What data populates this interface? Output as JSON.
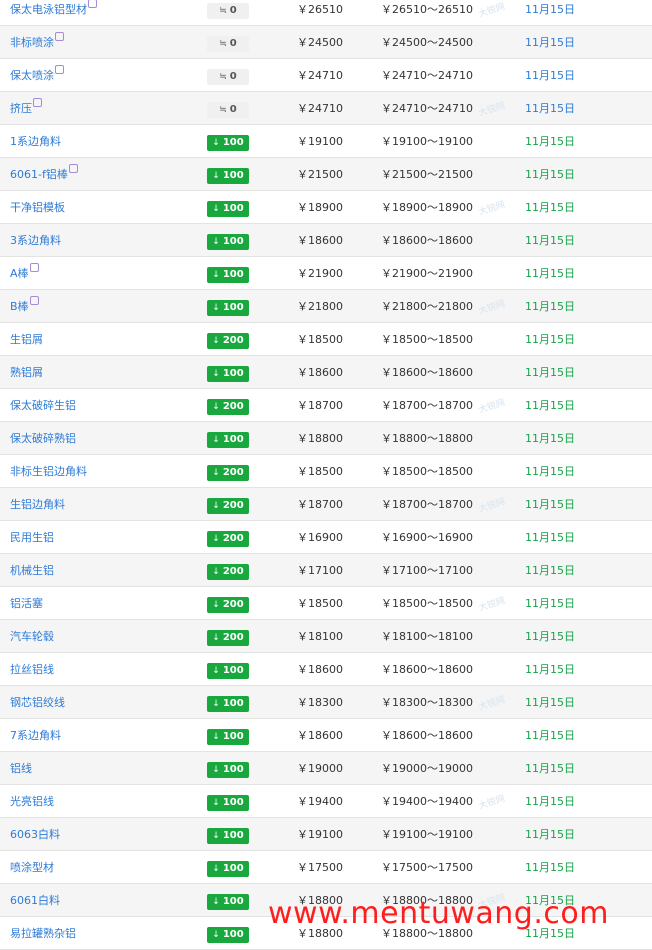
{
  "colors": {
    "link": "#2e7bd6",
    "down_badge": "#19a83e",
    "flat_badge": "#f0f0f0",
    "date_green": "#16a34a",
    "date_blue": "#2e7bd6",
    "watermark": "#ff1e1e"
  },
  "flat_icon": "≒",
  "down_icon": "↓",
  "watermark_text": "www.mentuwang.com",
  "row_watermark": "大锐网",
  "rows": [
    {
      "name": "保太电泳铝型材",
      "sup": true,
      "change": "0",
      "dir": "flat",
      "price": "￥26510",
      "range": "￥26510～26510",
      "date": "11月15日",
      "date_color": "blue"
    },
    {
      "name": "非标喷涂",
      "sup": true,
      "change": "0",
      "dir": "flat",
      "price": "￥24500",
      "range": "￥24500～24500",
      "date": "11月15日",
      "date_color": "blue"
    },
    {
      "name": "保太喷涂",
      "sup": true,
      "change": "0",
      "dir": "flat",
      "price": "￥24710",
      "range": "￥24710～24710",
      "date": "11月15日",
      "date_color": "blue"
    },
    {
      "name": "挤压",
      "sup": true,
      "change": "0",
      "dir": "flat",
      "price": "￥24710",
      "range": "￥24710～24710",
      "date": "11月15日",
      "date_color": "blue"
    },
    {
      "name": "1系边角料",
      "sup": false,
      "change": "100",
      "dir": "down",
      "price": "￥19100",
      "range": "￥19100～19100",
      "date": "11月15日",
      "date_color": "green"
    },
    {
      "name": "6061-f铝棒",
      "sup": true,
      "change": "100",
      "dir": "down",
      "price": "￥21500",
      "range": "￥21500～21500",
      "date": "11月15日",
      "date_color": "green"
    },
    {
      "name": "干净铝模板",
      "sup": false,
      "change": "100",
      "dir": "down",
      "price": "￥18900",
      "range": "￥18900～18900",
      "date": "11月15日",
      "date_color": "green"
    },
    {
      "name": "3系边角料",
      "sup": false,
      "change": "100",
      "dir": "down",
      "price": "￥18600",
      "range": "￥18600～18600",
      "date": "11月15日",
      "date_color": "green"
    },
    {
      "name": "A棒",
      "sup": true,
      "change": "100",
      "dir": "down",
      "price": "￥21900",
      "range": "￥21900～21900",
      "date": "11月15日",
      "date_color": "green"
    },
    {
      "name": "B棒",
      "sup": true,
      "change": "100",
      "dir": "down",
      "price": "￥21800",
      "range": "￥21800～21800",
      "date": "11月15日",
      "date_color": "green"
    },
    {
      "name": "生铝屑",
      "sup": false,
      "change": "200",
      "dir": "down",
      "price": "￥18500",
      "range": "￥18500～18500",
      "date": "11月15日",
      "date_color": "green"
    },
    {
      "name": "熟铝屑",
      "sup": false,
      "change": "100",
      "dir": "down",
      "price": "￥18600",
      "range": "￥18600～18600",
      "date": "11月15日",
      "date_color": "green"
    },
    {
      "name": "保太破碎生铝",
      "sup": false,
      "change": "200",
      "dir": "down",
      "price": "￥18700",
      "range": "￥18700～18700",
      "date": "11月15日",
      "date_color": "green"
    },
    {
      "name": "保太破碎熟铝",
      "sup": false,
      "change": "100",
      "dir": "down",
      "price": "￥18800",
      "range": "￥18800～18800",
      "date": "11月15日",
      "date_color": "green"
    },
    {
      "name": "非标生铝边角料",
      "sup": false,
      "change": "200",
      "dir": "down",
      "price": "￥18500",
      "range": "￥18500～18500",
      "date": "11月15日",
      "date_color": "green"
    },
    {
      "name": "生铝边角料",
      "sup": false,
      "change": "200",
      "dir": "down",
      "price": "￥18700",
      "range": "￥18700～18700",
      "date": "11月15日",
      "date_color": "green"
    },
    {
      "name": "民用生铝",
      "sup": false,
      "change": "200",
      "dir": "down",
      "price": "￥16900",
      "range": "￥16900～16900",
      "date": "11月15日",
      "date_color": "green"
    },
    {
      "name": "机械生铝",
      "sup": false,
      "change": "200",
      "dir": "down",
      "price": "￥17100",
      "range": "￥17100～17100",
      "date": "11月15日",
      "date_color": "green"
    },
    {
      "name": "铝活塞",
      "sup": false,
      "change": "200",
      "dir": "down",
      "price": "￥18500",
      "range": "￥18500～18500",
      "date": "11月15日",
      "date_color": "green"
    },
    {
      "name": "汽车轮毂",
      "sup": false,
      "change": "200",
      "dir": "down",
      "price": "￥18100",
      "range": "￥18100～18100",
      "date": "11月15日",
      "date_color": "green"
    },
    {
      "name": "拉丝铝线",
      "sup": false,
      "change": "100",
      "dir": "down",
      "price": "￥18600",
      "range": "￥18600～18600",
      "date": "11月15日",
      "date_color": "green"
    },
    {
      "name": "钢芯铝绞线",
      "sup": false,
      "change": "100",
      "dir": "down",
      "price": "￥18300",
      "range": "￥18300～18300",
      "date": "11月15日",
      "date_color": "green"
    },
    {
      "name": "7系边角料",
      "sup": false,
      "change": "100",
      "dir": "down",
      "price": "￥18600",
      "range": "￥18600～18600",
      "date": "11月15日",
      "date_color": "green"
    },
    {
      "name": "铝线",
      "sup": false,
      "change": "100",
      "dir": "down",
      "price": "￥19000",
      "range": "￥19000～19000",
      "date": "11月15日",
      "date_color": "green"
    },
    {
      "name": "光亮铝线",
      "sup": false,
      "change": "100",
      "dir": "down",
      "price": "￥19400",
      "range": "￥19400～19400",
      "date": "11月15日",
      "date_color": "green"
    },
    {
      "name": "6063白料",
      "sup": false,
      "change": "100",
      "dir": "down",
      "price": "￥19100",
      "range": "￥19100～19100",
      "date": "11月15日",
      "date_color": "green"
    },
    {
      "name": "喷涂型材",
      "sup": false,
      "change": "100",
      "dir": "down",
      "price": "￥17500",
      "range": "￥17500～17500",
      "date": "11月15日",
      "date_color": "green"
    },
    {
      "name": "6061白料",
      "sup": false,
      "change": "100",
      "dir": "down",
      "price": "￥18800",
      "range": "￥18800～18800",
      "date": "11月15日",
      "date_color": "green"
    },
    {
      "name": "易拉罐熟杂铝",
      "sup": false,
      "change": "100",
      "dir": "down",
      "price": "￥18800",
      "range": "￥18800～18800",
      "date": "11月15日",
      "date_color": "green"
    }
  ]
}
